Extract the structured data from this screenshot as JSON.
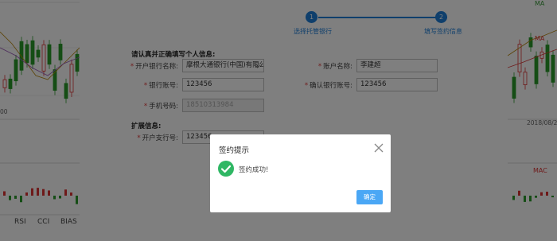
{
  "stepper": {
    "steps": [
      {
        "number": "1",
        "label": "选择托管银行"
      },
      {
        "number": "2",
        "label": "填写签约信息"
      }
    ]
  },
  "form": {
    "section_personal": "请认真并正确填写个人信息:",
    "section_extended": "扩展信息:",
    "fields": {
      "bank_name": {
        "label": "开户银行名称:",
        "value": "摩根大通银行(中国)有限公"
      },
      "account_name": {
        "label": "账户名称:",
        "value": "李建超"
      },
      "bank_account": {
        "label": "银行账号:",
        "value": "123456"
      },
      "confirm_account": {
        "label": "确认银行账号:",
        "value": "123456"
      },
      "phone": {
        "label": "手机号码:",
        "value": "18510313984"
      },
      "branch_no": {
        "label": "开户支行号:",
        "value": "123456"
      }
    }
  },
  "chart_left": {
    "tabs": [
      "RSI",
      "CCI",
      "BIAS"
    ],
    "value_label": "00"
  },
  "chart_right": {
    "date_label": "2018/08/2",
    "tag_top": "MA",
    "tag_mid": "MA",
    "tag_mac": "MAC"
  },
  "modal": {
    "title": "签约提示",
    "message": "签约成功!",
    "confirm_label": "确定"
  },
  "colors": {
    "primary": "#1f7fd8",
    "success": "#2fb764",
    "button": "#4aa7f5",
    "required": "#e03b3b"
  }
}
